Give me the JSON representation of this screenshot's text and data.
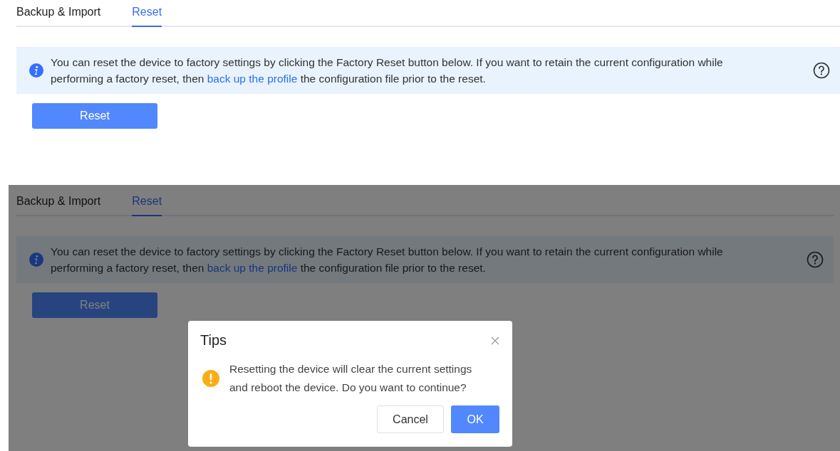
{
  "panels": [
    {
      "dimmed": false,
      "tabs": [
        {
          "label": "Backup & Import",
          "selected": false
        },
        {
          "label": "Reset",
          "selected": true
        }
      ],
      "notice": {
        "before": "You can reset the device to factory settings by clicking the Factory Reset button below. If you want to retain the current configuration while performing a factory reset, then ",
        "link": "back up the profile",
        "after": " the configuration file prior to the reset."
      },
      "button": "Reset"
    },
    {
      "dimmed": true,
      "tabs": [
        {
          "label": "Backup & Import",
          "selected": false
        },
        {
          "label": "Reset",
          "selected": true
        }
      ],
      "notice": {
        "before": "You can reset the device to factory settings by clicking the Factory Reset button below. If you want to retain the current configuration while performing a factory reset, then ",
        "link": "back up the profile",
        "after": " the configuration file prior to the reset."
      },
      "button": "Reset",
      "dialog": {
        "title": "Tips",
        "message": "Resetting the device will clear the current settings and reboot the device. Do you want to continue?",
        "buttons": [
          {
            "label": "Cancel",
            "kind": "secondary"
          },
          {
            "label": "OK",
            "kind": "primary"
          }
        ]
      }
    }
  ]
}
